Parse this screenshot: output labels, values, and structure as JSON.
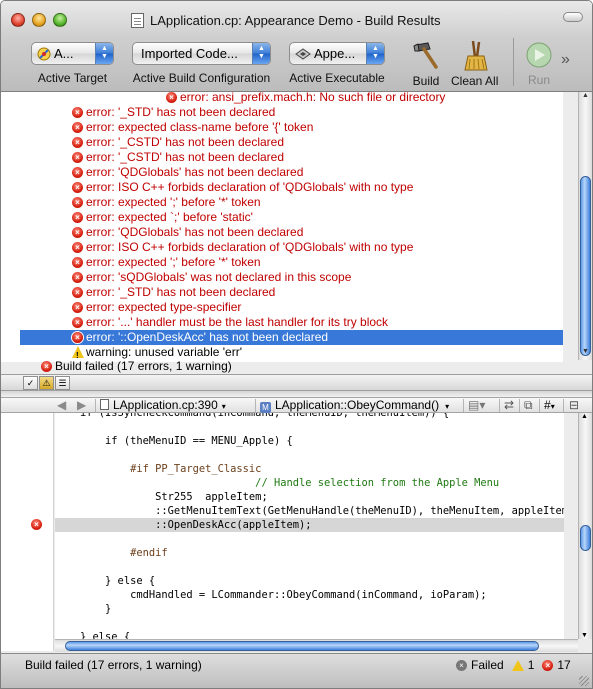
{
  "window": {
    "title": "LApplication.cp: Appearance Demo - Build Results"
  },
  "toolbar": {
    "active_target": {
      "value": "A...",
      "label": "Active Target"
    },
    "build_config": {
      "value": "Imported Code...",
      "label": "Active Build Configuration"
    },
    "active_exec": {
      "value": "Appe...",
      "label": "Active Executable"
    },
    "build_label": "Build",
    "clean_label": "Clean All",
    "run_label": "Run",
    "overflow": "»"
  },
  "messages": [
    {
      "kind": "error",
      "text": "error: ansi_prefix.mach.h: No such file or directory"
    },
    {
      "kind": "error",
      "text": "error: '_STD' has not been declared"
    },
    {
      "kind": "error",
      "text": "error: expected class-name before '{' token"
    },
    {
      "kind": "error",
      "text": "error: '_CSTD' has not been declared"
    },
    {
      "kind": "error",
      "text": "error: '_CSTD' has not been declared"
    },
    {
      "kind": "error",
      "text": "error: 'QDGlobals' has not been declared"
    },
    {
      "kind": "error",
      "text": "error: ISO C++ forbids declaration of 'QDGlobals' with no type"
    },
    {
      "kind": "error",
      "text": "error: expected ';' before '*' token"
    },
    {
      "kind": "error",
      "text": "error: expected `;' before 'static'"
    },
    {
      "kind": "error",
      "text": "error: 'QDGlobals' has not been declared"
    },
    {
      "kind": "error",
      "text": "error: ISO C++ forbids declaration of 'QDGlobals' with no type"
    },
    {
      "kind": "error",
      "text": "error: expected ';' before '*' token"
    },
    {
      "kind": "error",
      "text": "error: 'sQDGlobals' was not declared in this scope"
    },
    {
      "kind": "error",
      "text": "error: '_STD' has not been declared"
    },
    {
      "kind": "error",
      "text": "error: expected type-specifier"
    },
    {
      "kind": "error",
      "text": "error: '...' handler must be the last handler for its try block"
    },
    {
      "kind": "error",
      "text": "error: '::OpenDeskAcc' has not been declared",
      "selected": true
    },
    {
      "kind": "warning",
      "text": "warning: unused variable 'err'"
    }
  ],
  "summary": "Build failed (17 errors, 1 warning)",
  "editor": {
    "file": "LApplication.cp:390",
    "function": "LApplication::ObeyCommand()",
    "hash": "#",
    "lines": [
      {
        "text": "    if (IsSyncheckCommand(inCommand, theMenuID, theMenuItem)) {",
        "style": ""
      },
      {
        "text": "",
        "style": ""
      },
      {
        "text": "        if (theMenuID == MENU_Apple) {",
        "style": ""
      },
      {
        "text": "",
        "style": ""
      },
      {
        "text": "            #if PP_Target_Classic",
        "style": "pp"
      },
      {
        "text": "                                // Handle selection from the Apple Menu",
        "style": "cm"
      },
      {
        "text": "                Str255  appleItem;",
        "style": ""
      },
      {
        "text": "                ::GetMenuItemText(GetMenuHandle(theMenuID), theMenuItem, appleItem);",
        "style": ""
      },
      {
        "text": "                ::OpenDeskAcc(appleItem);",
        "style": "hl"
      },
      {
        "text": "",
        "style": ""
      },
      {
        "text": "            #endif",
        "style": "pp"
      },
      {
        "text": "",
        "style": ""
      },
      {
        "text": "        } else {",
        "style": ""
      },
      {
        "text": "            cmdHandled = LCommander::ObeyCommand(inCommand, ioParam);",
        "style": ""
      },
      {
        "text": "        }",
        "style": ""
      },
      {
        "text": "",
        "style": ""
      },
      {
        "text": "    } else {",
        "style": ""
      }
    ]
  },
  "status": {
    "text": "Build failed (17 errors, 1 warning)",
    "failed_label": "Failed",
    "warning_count": "1",
    "error_count": "17"
  },
  "colors": {
    "error_text": "#c00000",
    "selection": "#3878d8",
    "code_comment": "#1f7a12",
    "code_preprocessor": "#6b3f1c"
  }
}
